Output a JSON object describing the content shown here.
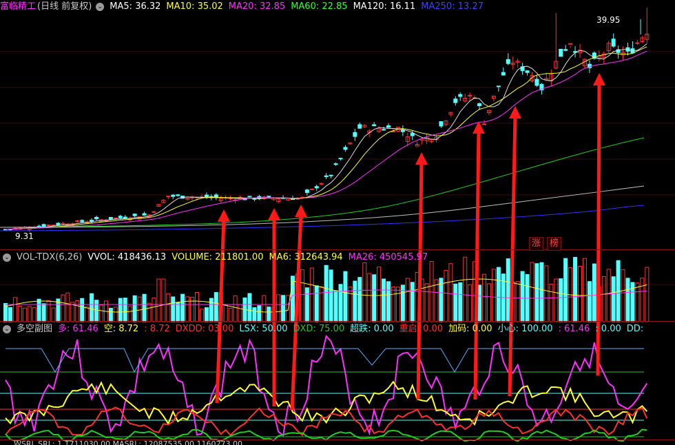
{
  "colors": {
    "up": "#ff3030",
    "down": "#54ffff",
    "ma5": "#e0e0e0",
    "ma10": "#ffff30",
    "ma20": "#ff30ff",
    "ma60": "#20d020",
    "ma120": "#c0c0c0",
    "ma250": "#3030ff"
  },
  "main": {
    "stock_name": "富临精工",
    "mode": "(日线 前复权)",
    "indicators": [
      {
        "label": "MA5: 36.32",
        "color": "#ffffff"
      },
      {
        "label": "MA10: 35.02",
        "color": "#ffff30"
      },
      {
        "label": "MA20: 32.85",
        "color": "#ff30ff"
      },
      {
        "label": "MA60: 22.85",
        "color": "#30ff30"
      },
      {
        "label": "MA120: 16.11",
        "color": "#ffffff"
      },
      {
        "label": "MA250: 13.27",
        "color": "#4040ff"
      }
    ],
    "high_label": "39.95",
    "low_label": "9.31",
    "badges": [
      "涨",
      "榜"
    ]
  },
  "volume": {
    "name": "VOL-TDX(6,26)",
    "indicators": [
      {
        "label": "VVOL: 418436.13",
        "color": "#ffffff"
      },
      {
        "label": "VOLUME: 211801.00",
        "color": "#ffff30"
      },
      {
        "label": "MA6: 312643.94",
        "color": "#ffff30"
      },
      {
        "label": "MA26: 450545.97",
        "color": "#ff30ff"
      }
    ]
  },
  "sub": {
    "name": "多空副图",
    "indicators": [
      {
        "label": "多: 61.46",
        "color": "#ff30ff"
      },
      {
        "label": "空: 8.72",
        "color": "#ffff30"
      },
      {
        "label": ": 8.72",
        "color": "#ff3030"
      },
      {
        "label": "DXDD: 03.00",
        "color": "#ff3030"
      },
      {
        "label": "LSX: 50.00",
        "color": "#54ffff"
      },
      {
        "label": "DXD: 75.00",
        "color": "#30c030"
      },
      {
        "label": "超跌: 0.00",
        "color": "#54ffff"
      },
      {
        "label": "重启: 0.00",
        "color": "#ff3030"
      },
      {
        "label": "加码: 0.00",
        "color": "#ffff30"
      },
      {
        "label": "小心: 100.00",
        "color": "#54ffff"
      },
      {
        "label": ": 61.46",
        "color": "#ff30ff"
      },
      {
        "label": ": 0.00",
        "color": "#54ffff"
      },
      {
        "label": "DD:",
        "color": "#54ffff"
      }
    ]
  },
  "bottom": {
    "text": "WSRL SRL: 1 1711030.00   MASRL: 12087535.00   1160273.00"
  }
}
